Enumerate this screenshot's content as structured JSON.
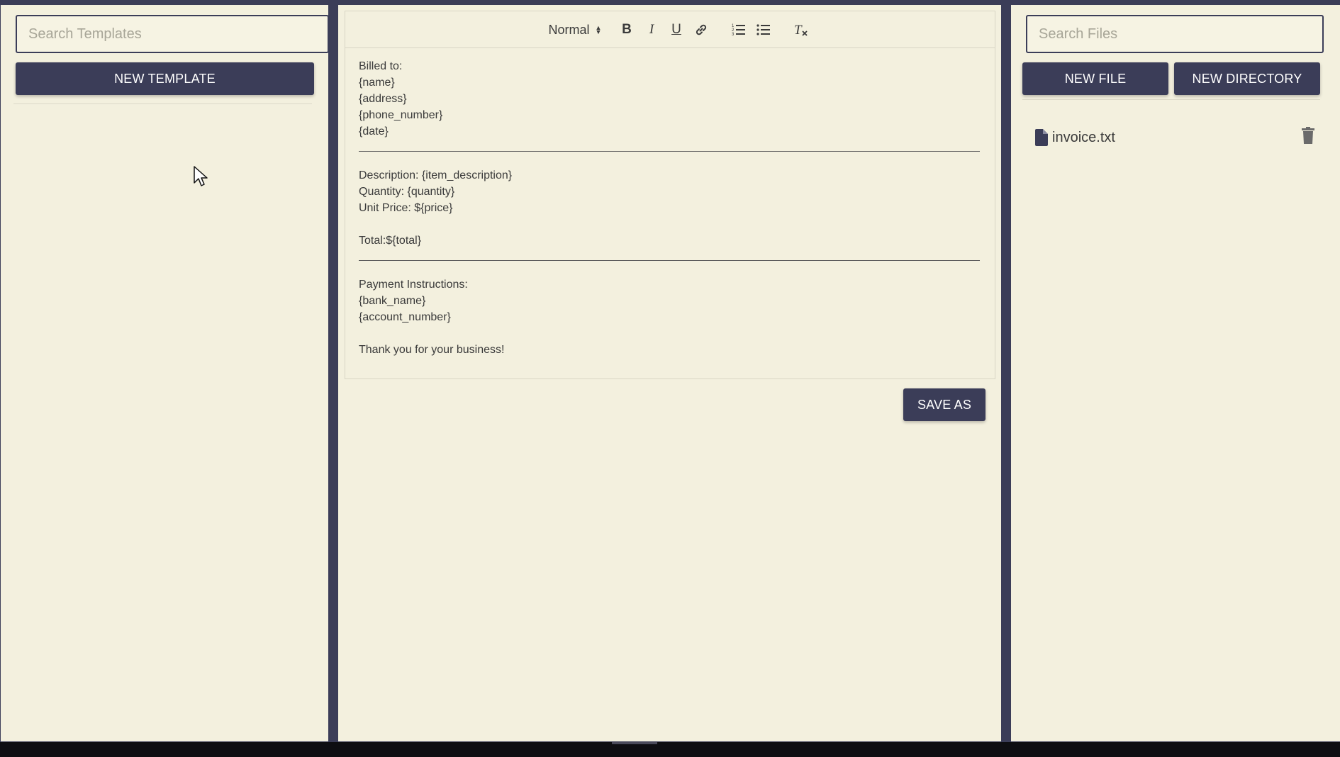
{
  "left_panel": {
    "search": {
      "placeholder": "Search Templates",
      "value": ""
    },
    "new_template_label": "NEW TEMPLATE"
  },
  "editor": {
    "toolbar": {
      "heading_select": "Normal",
      "bold": "B",
      "italic": "I",
      "underline": "U",
      "icons": [
        "link-icon",
        "ordered-list-icon",
        "bullet-list-icon",
        "clear-format-icon"
      ]
    },
    "lines": {
      "billed_to": "Billed to:",
      "name": "{name}",
      "address": "{address}",
      "phone": "{phone_number}",
      "date": "{date}",
      "description": "Description: {item_description}",
      "quantity": "Quantity: {quantity}",
      "unit_price": "Unit Price: ${price}",
      "total": "Total:${total}",
      "payment_instructions": "Payment Instructions:",
      "bank_name": "{bank_name}",
      "account_number": "{account_number}",
      "thanks": "Thank you for your business!"
    },
    "save_as_label": "SAVE AS"
  },
  "right_panel": {
    "search": {
      "placeholder": "Search Files",
      "value": ""
    },
    "new_file_label": "NEW FILE",
    "new_directory_label": "NEW DIRECTORY",
    "files": [
      {
        "name": "invoice.txt",
        "icon": "file-icon",
        "action_icon": "trash-icon"
      }
    ]
  },
  "colors": {
    "panel_bg": "#f3f0de",
    "accent": "#3b3d58",
    "frame_bg": "#3b3d58"
  }
}
